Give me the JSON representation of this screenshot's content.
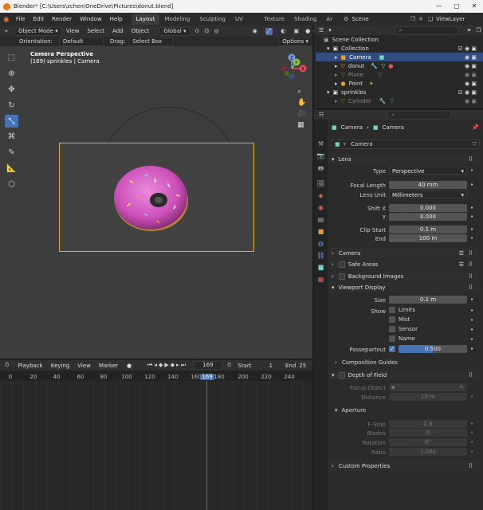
{
  "window": {
    "title": "Blender* [C:\\Users\\zchen\\OneDrive\\Pictures\\donut.blend]",
    "min": "—",
    "max": "▢",
    "close": "✕"
  },
  "menu": [
    "File",
    "Edit",
    "Render",
    "Window",
    "Help"
  ],
  "workspaces": [
    "Layout",
    "Modeling",
    "Sculpting",
    "UV Editing",
    "Texture Paint",
    "Shading",
    "Ar"
  ],
  "scene": {
    "label": "Scene",
    "viewlayer": "ViewLayer"
  },
  "viewport_header": {
    "mode": "Object Mode",
    "items": [
      "View",
      "Select",
      "Add",
      "Object"
    ],
    "orientation_value": "Global"
  },
  "tool_header": {
    "orientation_label": "Orientation:",
    "orientation": "Default",
    "drag_label": "Drag:",
    "drag": "Select Box",
    "options": "Options"
  },
  "viewport": {
    "line1": "Camera Perspective",
    "line2": "(169) sprinkles | Camera",
    "gizmo": {
      "x": "X",
      "y": "Y",
      "z": "Z"
    }
  },
  "outliner": {
    "title": "Scene Collection",
    "rows": [
      "Collection",
      "Camera",
      "donut",
      "Plane",
      "Point",
      "sprinkles",
      "Cylinder"
    ]
  },
  "timeline_header": {
    "playback": "Playback",
    "keying": "Keying",
    "view": "View",
    "marker": "Marker",
    "frame": "169",
    "start_label": "Start",
    "start": "1",
    "end_label": "End",
    "end": "25"
  },
  "timeline_ticks": [
    "0",
    "20",
    "40",
    "60",
    "80",
    "100",
    "120",
    "140",
    "160",
    "169",
    "180",
    "200",
    "220",
    "240"
  ],
  "props": {
    "breadcrumb": [
      "Camera",
      "Camera"
    ],
    "datablock": "Camera",
    "lens": {
      "title": "Lens",
      "type_label": "Type",
      "type": "Perspective",
      "focal_label": "Focal Length",
      "focal": "40 mm",
      "unit_label": "Lens Unit",
      "unit": "Millimeters",
      "shiftx_label": "Shift X",
      "shiftx": "0.000",
      "shifty_label": "Y",
      "shifty": "0.000",
      "clipstart_label": "Clip Start",
      "clipstart": "0.1 m",
      "end_label": "End",
      "end": "100 m"
    },
    "camera": "Camera",
    "safe_areas": "Safe Areas",
    "bg_images": "Background Images",
    "viewport_display": {
      "title": "Viewport Display",
      "size_label": "Size",
      "size": "0.1 m",
      "show_label": "Show",
      "limits": "Limits",
      "mist": "Mist",
      "sensor": "Sensor",
      "name": "Name",
      "passe_label": "Passepartout",
      "passe": "0.500",
      "passe_fraction": 0.5,
      "comp": "Composition Guides"
    },
    "dof": {
      "title": "Depth of Field",
      "focus_label": "Focus Object",
      "distance_label": "Distance",
      "distance": "10 m"
    },
    "aperture": {
      "title": "Aperture",
      "fstop_label": "F-Stop",
      "fstop": "2.8",
      "blades_label": "Blades",
      "blades": "0",
      "rotation_label": "Rotation",
      "rotation": "0°",
      "ratio_label": "Ratio",
      "ratio": "1.000"
    },
    "custom": "Custom Properties"
  },
  "colors": {
    "accent": "#4772b3",
    "selected_row": "#334d80",
    "donut": "#d65bc2"
  }
}
